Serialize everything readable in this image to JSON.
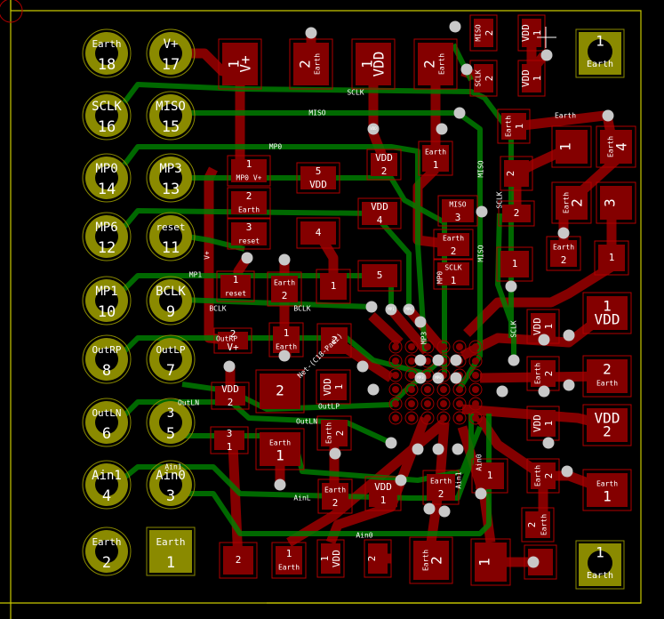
{
  "colors": {
    "background": "#000000",
    "copper_front": "#840000",
    "copper_back": "#008000",
    "pad_outline": "#b00000",
    "connector": "#8a8a00",
    "via": "#c8c8c8",
    "board_edge": "#c8c800"
  },
  "connector_pins": [
    {
      "name": "Earth",
      "num": "18"
    },
    {
      "name": "V+",
      "num": "17"
    },
    {
      "name": "SCLK",
      "num": "16"
    },
    {
      "name": "MISO",
      "num": "15"
    },
    {
      "name": "MP0",
      "num": "14"
    },
    {
      "name": "MP3",
      "num": "13"
    },
    {
      "name": "MP6",
      "num": "12"
    },
    {
      "name": "reset",
      "num": "11"
    },
    {
      "name": "MP1",
      "num": "10"
    },
    {
      "name": "BCLK",
      "num": "9"
    },
    {
      "name": "OutRP",
      "num": "8"
    },
    {
      "name": "OutLP",
      "num": "7"
    },
    {
      "name": "OutLN",
      "num": "6"
    },
    {
      "name": "3",
      "num": "5"
    },
    {
      "name": "Ain1",
      "num": "4"
    },
    {
      "name": "Ain0",
      "num": "3"
    },
    {
      "name": "Earth",
      "num": "2"
    },
    {
      "name": "Earth",
      "num": "1"
    }
  ],
  "mount_pads": [
    {
      "num": "1",
      "name": "Earth"
    },
    {
      "num": "1",
      "name": "Earth"
    }
  ],
  "pads": [
    [
      "1",
      "V+"
    ],
    [
      "2",
      "Earth"
    ],
    [
      "1",
      "VDD"
    ],
    [
      "2",
      "Earth"
    ],
    [
      "MISO",
      "2"
    ],
    [
      "SCLK",
      "2"
    ],
    [
      "VDD",
      "1"
    ],
    [
      "VDD",
      "1"
    ],
    [
      "1",
      "MP0 V+"
    ],
    [
      "2",
      "Earth"
    ],
    [
      "3",
      "reset"
    ],
    [
      "5",
      "VDD"
    ],
    [
      "VDD",
      "2"
    ],
    [
      "VDD",
      "4"
    ],
    [
      "4",
      ""
    ],
    [
      "5",
      ""
    ],
    [
      "1",
      "reset"
    ],
    [
      "Earth",
      "2"
    ],
    [
      "1",
      ""
    ],
    [
      "Earth",
      "1"
    ],
    [
      "MISO",
      "3"
    ],
    [
      "Earth",
      "2"
    ],
    [
      "SCLK",
      "1"
    ],
    [
      "Earth",
      "1"
    ],
    [
      "2",
      ""
    ],
    [
      "2",
      ""
    ],
    [
      "1",
      ""
    ],
    [
      "Earth",
      "4"
    ],
    [
      "Earth",
      "2"
    ],
    [
      "3",
      ""
    ],
    [
      "Earth",
      "2"
    ],
    [
      "1",
      ""
    ],
    [
      "1",
      ""
    ],
    [
      "1",
      "VDD"
    ],
    [
      "VDD",
      "1"
    ],
    [
      "2",
      "Earth"
    ],
    [
      "Earth",
      "2"
    ],
    [
      "VDD",
      "2"
    ],
    [
      "VDD",
      "1"
    ],
    [
      "Earth",
      "1"
    ],
    [
      "Earth",
      "2"
    ],
    [
      "2",
      "Earth"
    ],
    [
      "1",
      ""
    ],
    [
      "1",
      ""
    ],
    [
      "1",
      ""
    ],
    [
      "2",
      "V+"
    ],
    [
      "1",
      "Earth"
    ],
    [
      "2",
      ""
    ],
    [
      "2",
      ""
    ],
    [
      "VDD",
      "1"
    ],
    [
      "VDD",
      "2"
    ],
    [
      "3",
      "1"
    ],
    [
      "Earth",
      "1"
    ],
    [
      "Earth",
      "2"
    ],
    [
      "Earth",
      "2"
    ],
    [
      "VDD",
      "1"
    ],
    [
      "Earth",
      "2"
    ],
    [
      "2",
      ""
    ],
    [
      "1",
      "Earth"
    ],
    [
      "1",
      "VDD"
    ],
    [
      "2",
      ""
    ],
    [
      "Earth",
      "2"
    ]
  ],
  "net_labels": [
    "SCLK",
    "MISO",
    "MP0",
    "MP1",
    "BCLK",
    "BCLK",
    "OutRP",
    "OutLN",
    "OutLP",
    "OutLN",
    "Ain1",
    "AinL",
    "Ain0",
    "MISO",
    "SCLK",
    "MISO",
    "MP3",
    "MP0",
    "SCLK",
    "Ain0",
    "Ain1",
    "Earth",
    "Net-(C18-Pad2)",
    "V+"
  ],
  "via_labels": [
    "VDD",
    "MP1",
    "MP6",
    "MP3",
    "MP0"
  ]
}
